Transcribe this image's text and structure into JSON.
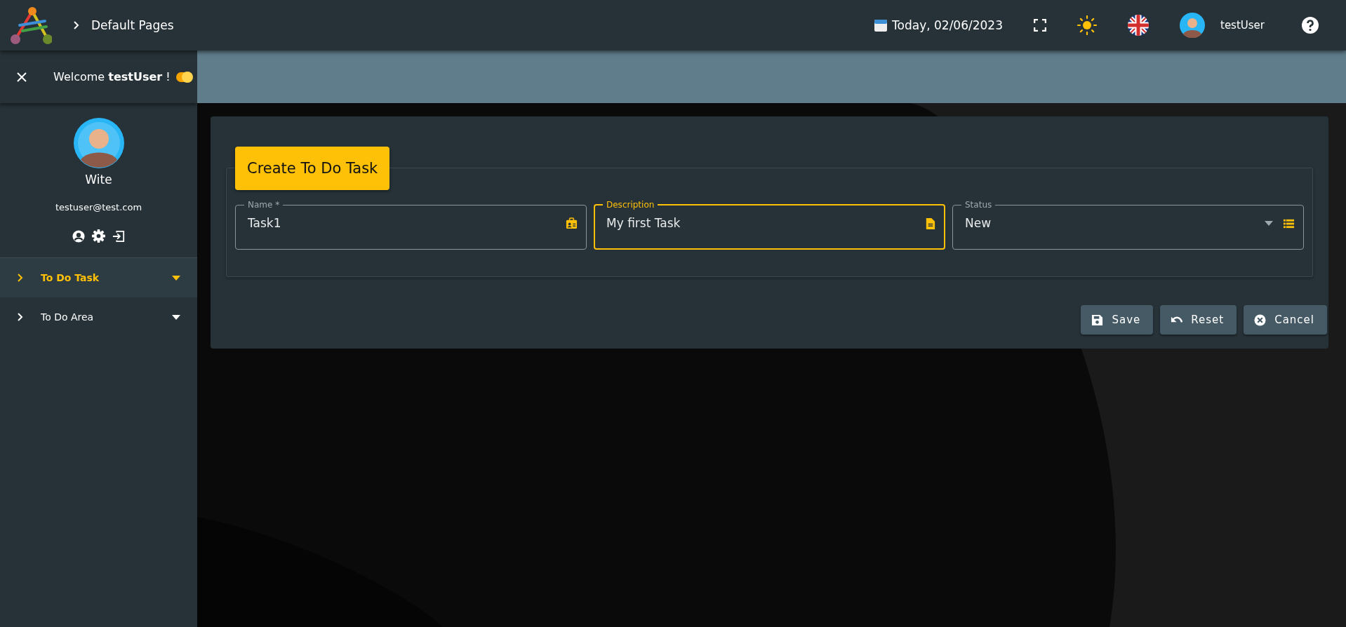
{
  "topbar": {
    "breadcrumb": "Default Pages",
    "date": "Today, 02/06/2023",
    "user": "testUser"
  },
  "sidebar": {
    "welcome": "Welcome **testUser** !",
    "theme_toggle": {
      "on": true
    },
    "profile": {
      "name": "Wite",
      "email": "testuser@test.com"
    },
    "menu": [
      {
        "label": "To Do Task",
        "selected": true
      },
      {
        "label": "To Do Area",
        "selected": false
      }
    ]
  },
  "form": {
    "title": "Create To Do Task",
    "fields": [
      {
        "kind": "text",
        "label": "Name *",
        "value": "Task1",
        "focused": false
      },
      {
        "kind": "text",
        "label": "Description",
        "value": "My first Task",
        "focused": true
      },
      {
        "kind": "select",
        "label": "Status",
        "value": "New",
        "focused": false
      }
    ],
    "buttons": [
      "Save",
      "Reset",
      "Cancel"
    ]
  }
}
